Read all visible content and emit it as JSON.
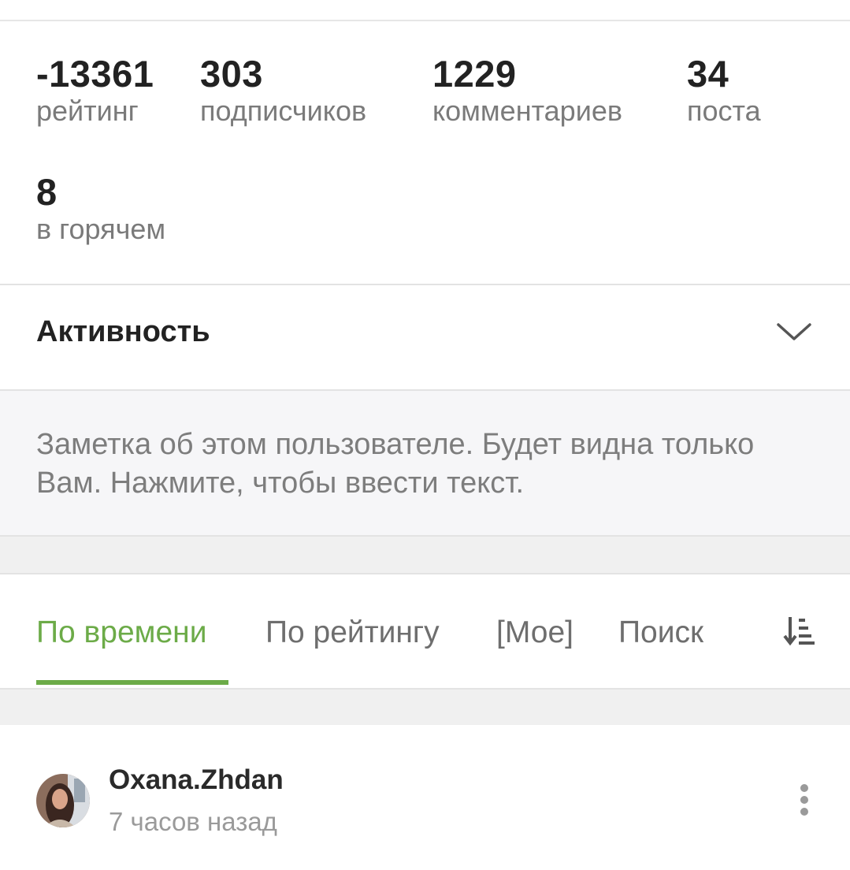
{
  "stats": {
    "rating": {
      "value": "-13361",
      "label": "рейтинг"
    },
    "subscribers": {
      "value": "303",
      "label": "подписчиков"
    },
    "comments": {
      "value": "1229",
      "label": "комментариев"
    },
    "posts": {
      "value": "34",
      "label": "поста"
    },
    "hot": {
      "value": "8",
      "label": "в горячем"
    }
  },
  "activity": {
    "title": "Активность",
    "icon": "chevron-down-icon"
  },
  "note": {
    "placeholder": "Заметка об этом пользователе. Будет видна только Вам. Нажмите, чтобы ввести текст."
  },
  "tabs": [
    {
      "label": "По времени",
      "active": true
    },
    {
      "label": "По рейтингу",
      "active": false
    },
    {
      "label": "[Мое]",
      "active": false
    },
    {
      "label": "Поиск",
      "active": false
    }
  ],
  "sort_icon": "sort-icon",
  "comment": {
    "author": "Oxana.Zhdan",
    "time": "7 часов назад",
    "more_icon": "more-vertical-icon"
  },
  "colors": {
    "accent": "#6cab48",
    "muted_text": "#7a7a7a",
    "note_background": "#f6f6f8"
  }
}
